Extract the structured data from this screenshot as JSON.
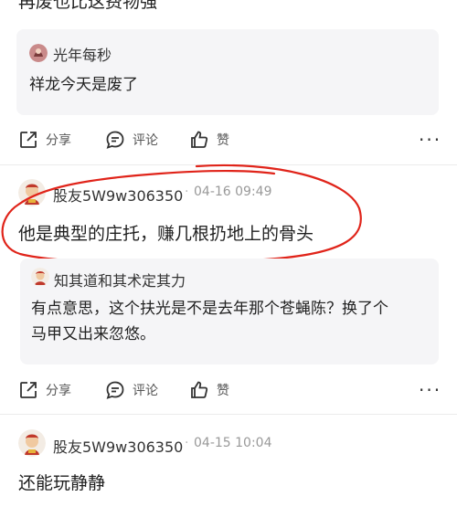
{
  "top_comment": {
    "text": "再废也比这费物强"
  },
  "reply_1": {
    "user": "光年每秒",
    "text": "祥龙今天是废了"
  },
  "actions": {
    "share": "分享",
    "comment": "评论",
    "like": "赞",
    "more": "···"
  },
  "comment_1": {
    "user": "股友5W9w306350",
    "time": "04-16 09:49",
    "text": "他是典型的庄托，赚几根扔地上的骨头",
    "reply": {
      "user": "知其道和其术定其力",
      "line1": "有点意思，这个扶光是不是去年那个苍蝇陈？换了个",
      "line2": "马甲又出来忽悠。"
    }
  },
  "comment_2": {
    "user": "股友5W9w306350",
    "time": "04-15 10:04",
    "text": "还能玩静静"
  },
  "colors": {
    "annotation": "#e0241a",
    "quote_bg": "#f5f5f7"
  },
  "separator": "·"
}
